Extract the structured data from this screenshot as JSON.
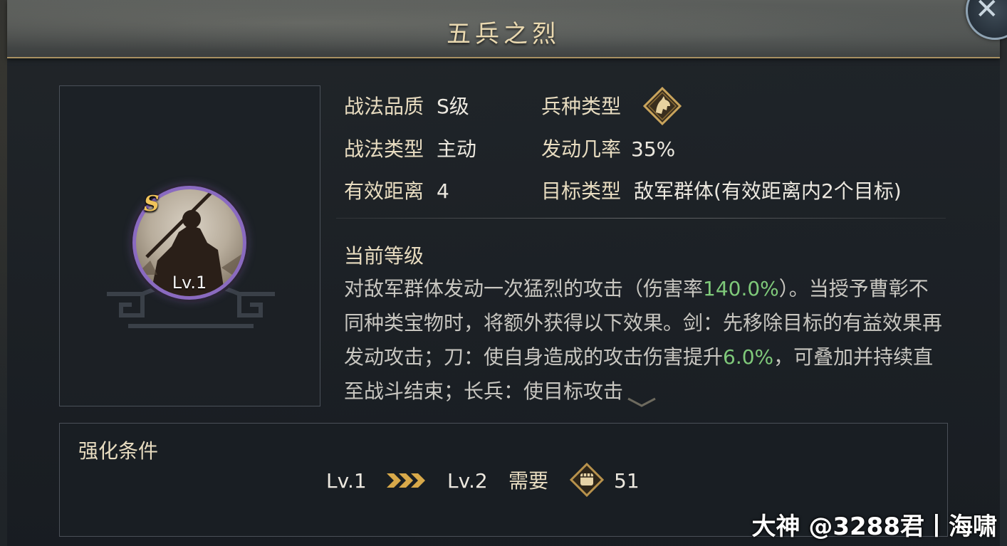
{
  "window": {
    "title": "五兵之烈",
    "close_icon": "close-x-icon"
  },
  "skill": {
    "grade_badge": "S",
    "level": "Lv.1"
  },
  "attributes": {
    "quality_label": "战法品质",
    "quality_value": "S级",
    "troop_label": "兵种类型",
    "troop_icon": "cavalry-horse-icon",
    "type_label": "战法类型",
    "type_value": "主动",
    "rate_label": "发动几率",
    "rate_value": "35%",
    "range_label": "有效距离",
    "range_value": "4",
    "target_label": "目标类型",
    "target_value": "敌军群体(有效距离内2个目标)"
  },
  "current_level": {
    "title": "当前等级",
    "desc_part1": "对敌军群体发动一次猛烈的攻击（伤害率",
    "desc_hl1": "140.0%",
    "desc_part2": "）。当授予曹彰不同种类宝物时，将额外获得以下效果。剑：先移除目标的有益效果再发动攻击；刀：使自身造成的攻击伤害提升",
    "desc_hl2": "6.0%",
    "desc_part3": "，可叠加并持续直至战斗结束；长兵：使目标攻击"
  },
  "upgrade": {
    "title": "强化条件",
    "from_level": "Lv.1",
    "to_level": "Lv.2",
    "need_label": "需要",
    "cost_icon": "fist-token-icon",
    "cost_value": "51"
  },
  "watermark": "大神 @3288君丨海啸",
  "colors": {
    "gold_text": "#e8dcc0",
    "highlight_green": "#7fc97a",
    "grade_frame_purple": "#8a6ac0",
    "title_gold": "#ead9b0"
  }
}
